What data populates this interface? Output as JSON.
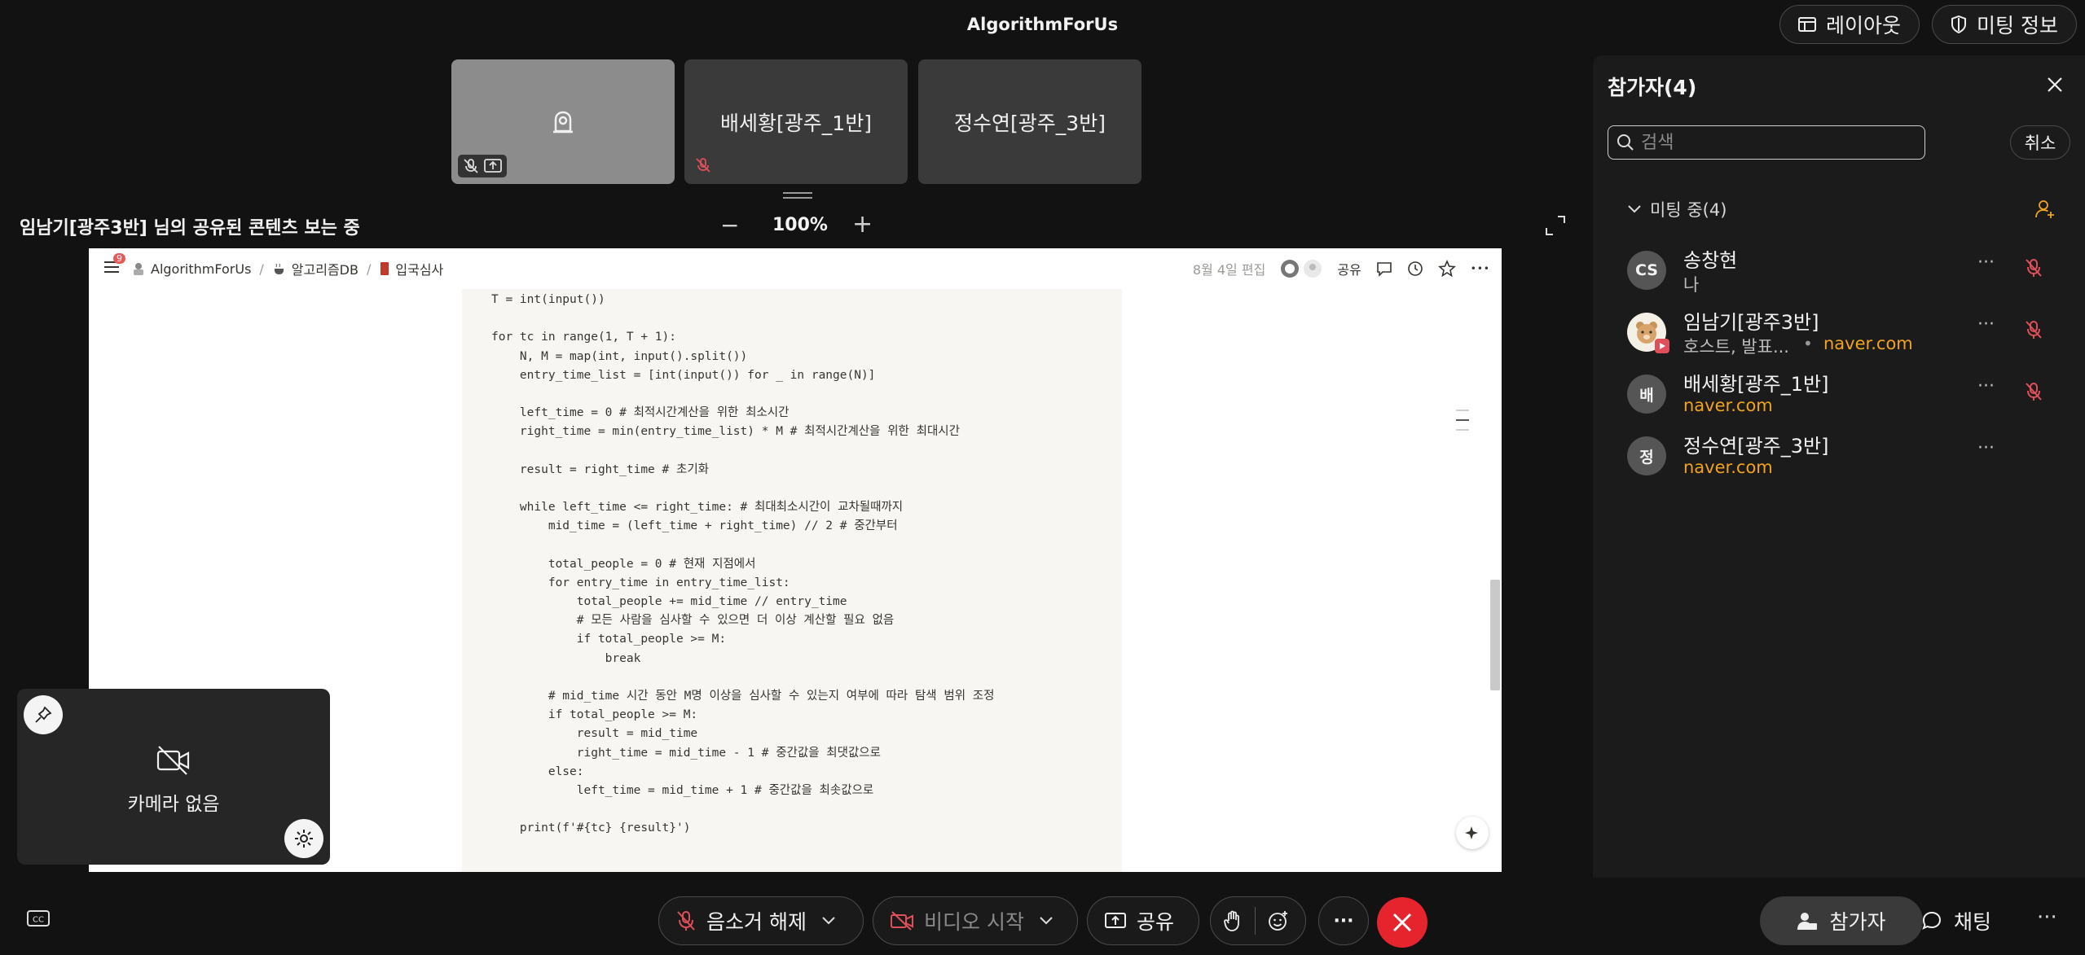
{
  "meeting": {
    "title": "AlgorithmForUs"
  },
  "header": {
    "layout_label": "레이아웃",
    "info_label": "미팅 정보"
  },
  "tiles": [
    {
      "name": ""
    },
    {
      "name": "배세황[광주_1반]"
    },
    {
      "name": "정수연[광주_3반]"
    }
  ],
  "share": {
    "label": "임남기[광주3반] 님의 공유된 콘텐츠 보는 중",
    "zoom_minus": "−",
    "zoom": "100%",
    "zoom_plus": "+"
  },
  "notion": {
    "badge": "9",
    "breadcrumb": [
      "AlgorithmForUs",
      "알고리즘DB",
      "입국심사"
    ],
    "edited": "8월 4일 편집",
    "share_label": "공유",
    "more": "•••"
  },
  "code": [
    "T = int(input())",
    "",
    "for tc in range(1, T + 1):",
    "    N, M = map(int, input().split())",
    "    entry_time_list = [int(input()) for _ in range(N)]",
    "",
    "    left_time = 0 # 최적시간계산을 위한 최소시간",
    "    right_time = min(entry_time_list) * M # 최적시간계산을 위한 최대시간",
    "",
    "    result = right_time # 초기화",
    "",
    "    while left_time <= right_time: # 최대최소시간이 교차될때까지",
    "        mid_time = (left_time + right_time) // 2 # 중간부터",
    "",
    "        total_people = 0 # 현재 지점에서",
    "        for entry_time in entry_time_list:",
    "            total_people += mid_time // entry_time",
    "            # 모든 사람을 심사할 수 있으면 더 이상 계산할 필요 없음",
    "            if total_people >= M:",
    "                break",
    "",
    "        # mid_time 시간 동안 M명 이상을 심사할 수 있는지 여부에 따라 탐색 범위 조정",
    "        if total_people >= M:",
    "            result = mid_time",
    "            right_time = mid_time - 1 # 중간값을 최댓값으로",
    "        else:",
    "            left_time = mid_time + 1 # 중간값을 최솟값으로",
    "",
    "    print(f'#{tc} {result}')"
  ],
  "self_view": {
    "no_camera": "카메라 없음"
  },
  "toolbar": {
    "unmute": "음소거 해제",
    "video": "비디오 시작",
    "share": "공유",
    "more": "···"
  },
  "bottom_right": {
    "participants": "참가자",
    "chat": "채팅",
    "more": "···"
  },
  "panel": {
    "title": "참가자(4)",
    "search_placeholder": "검색",
    "cancel": "취소",
    "group": "미팅 중(4)",
    "participants": [
      {
        "initials": "CS",
        "name": "송창현",
        "sub": "나",
        "org": ""
      },
      {
        "initials": "",
        "name": "임남기[광주3반]",
        "sub": "호스트, 발표...",
        "org": "naver.com"
      },
      {
        "initials": "배",
        "name": "배세황[광주_1반]",
        "sub": "",
        "org": "naver.com"
      },
      {
        "initials": "정",
        "name": "정수연[광주_3반]",
        "sub": "",
        "org": "naver.com"
      }
    ],
    "more": "···"
  },
  "colors": {
    "accent_org": "#f2a31b",
    "leave": "#e5242e",
    "muted_red": "#e0505a"
  }
}
